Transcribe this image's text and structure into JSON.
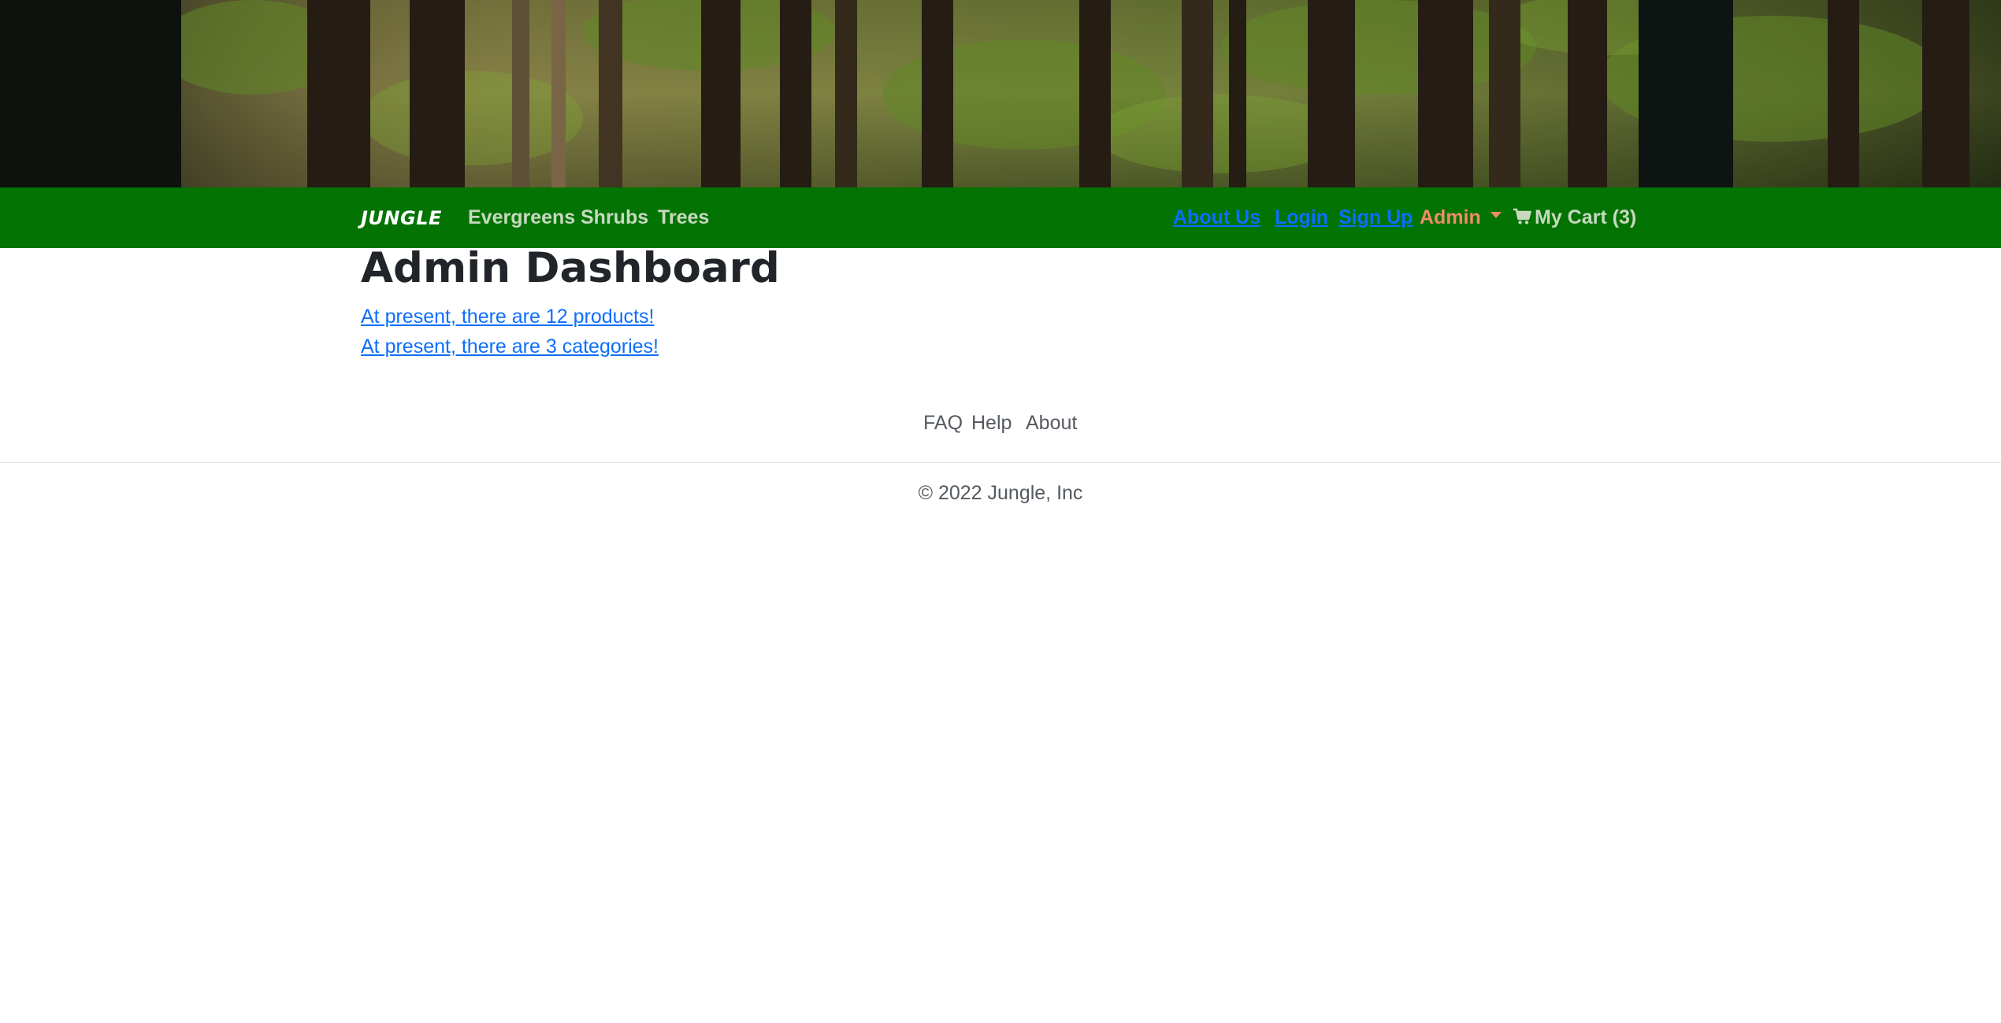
{
  "navbar": {
    "brand": "JUNGLE",
    "categories": [
      "Evergreens",
      "Shrubs",
      "Trees"
    ],
    "about_us": "About Us",
    "login": "Login",
    "sign_up": "Sign Up",
    "admin": "Admin",
    "cart": "My Cart (3)"
  },
  "main": {
    "title": "Admin Dashboard",
    "products_link": "At present, there are 12 products!",
    "categories_link": "At present, there are 3 categories!"
  },
  "footer": {
    "links": [
      "FAQ",
      "Help",
      "About"
    ],
    "copyright": "© 2022 Jungle, Inc"
  },
  "colors": {
    "navbar_bg": "#037303",
    "link_blue": "#0d6efd",
    "admin_accent": "#f08b6c",
    "nav_text": "#c8d9c0"
  }
}
